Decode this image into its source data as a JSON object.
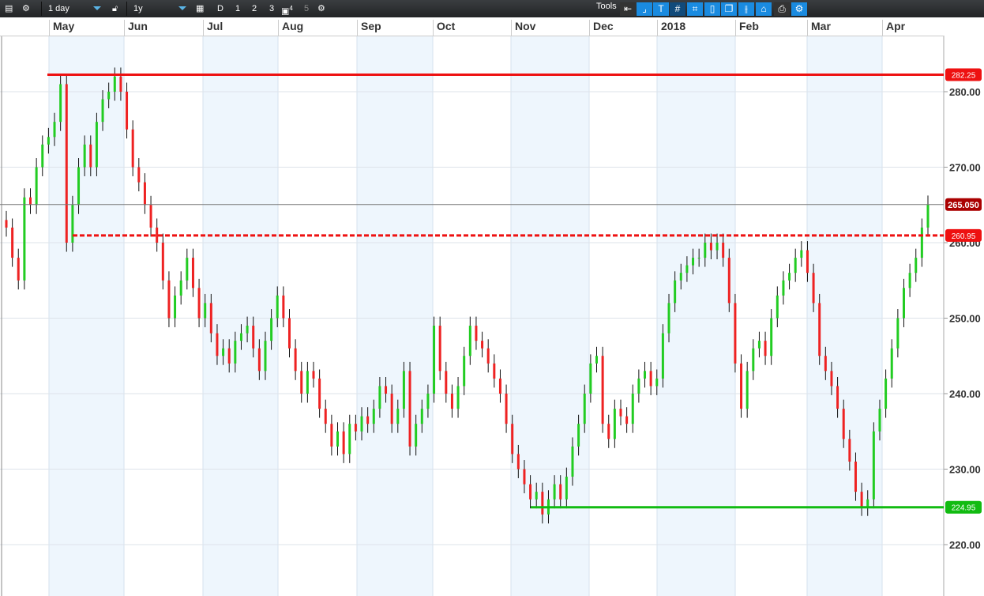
{
  "toolbar": {
    "interval": "1 day",
    "range": "1y",
    "d": "D",
    "n1": "1",
    "n2": "2",
    "n3": "3",
    "n4": "4",
    "n5": "5",
    "tools": "Tools"
  },
  "icons": [
    "list-icon",
    "gear-icon",
    "lock-icon",
    "calendar-icon",
    "save-icon",
    "back-arrow-icon",
    "curve-icon",
    "text-icon",
    "grid-icon",
    "draw-grid-icon",
    "candle-icon",
    "layers-icon",
    "ohlc-icon",
    "label-icon",
    "print-icon",
    "settings-icon"
  ],
  "chart_data": {
    "type": "candlestick",
    "x_tick_labels": [
      "May",
      "Jun",
      "Jul",
      "Aug",
      "Sep",
      "Oct",
      "Nov",
      "Dec",
      "2018",
      "Feb",
      "Mar",
      "Apr"
    ],
    "y_tick_labels": [
      "280.00",
      "270.00",
      "260.00",
      "250.00",
      "240.00",
      "230.00",
      "220.00"
    ],
    "y_ticks": [
      280,
      270,
      260,
      250,
      240,
      230,
      220
    ],
    "ylim": [
      212,
      291
    ],
    "close": [
      262,
      258,
      255,
      266,
      265,
      270,
      273,
      274,
      276,
      281,
      260,
      265,
      270,
      273,
      270,
      276,
      279,
      280,
      282,
      280,
      275,
      270,
      268,
      265,
      262,
      260,
      255,
      250,
      253,
      255,
      258,
      254,
      250,
      252,
      248,
      245,
      246,
      244,
      247,
      248,
      249,
      246,
      243,
      247,
      250,
      253,
      250,
      246,
      243,
      240,
      243,
      242,
      238,
      236,
      233,
      235,
      232,
      236,
      235,
      237,
      236,
      238,
      241,
      240,
      236,
      238,
      243,
      233,
      236,
      238,
      240,
      249,
      243,
      240,
      238,
      241,
      245,
      249,
      247,
      246,
      244,
      242,
      240,
      236,
      232,
      230,
      228,
      226,
      227,
      224,
      226,
      228,
      226,
      229,
      233,
      236,
      240,
      244,
      245,
      236,
      234,
      238,
      237,
      236,
      240,
      242,
      243,
      241,
      242,
      248,
      252,
      255,
      256,
      257,
      258,
      258,
      260,
      259,
      260,
      258,
      252,
      244,
      238,
      243,
      246,
      247,
      245,
      250,
      253,
      255,
      256,
      258,
      259,
      256,
      252,
      245,
      243,
      241,
      238,
      234,
      231,
      227,
      225,
      226,
      235,
      238,
      242,
      246,
      250,
      254,
      256,
      258,
      262,
      265.05
    ],
    "levels": [
      {
        "label": "282.25",
        "value": 282.25,
        "color": "#ee1111",
        "style": "solid"
      },
      {
        "label": "260.95",
        "value": 260.95,
        "color": "#ee1111",
        "style": "dashed"
      },
      {
        "label": "224.95",
        "value": 224.95,
        "color": "#11bb11",
        "style": "solid"
      },
      {
        "label": "265.050",
        "value": 265.05,
        "color": "#aa0000",
        "style": "last"
      }
    ],
    "colors": {
      "up": "#22cc22",
      "down": "#ee2222",
      "band": "#eef6fd"
    },
    "grid": true
  }
}
